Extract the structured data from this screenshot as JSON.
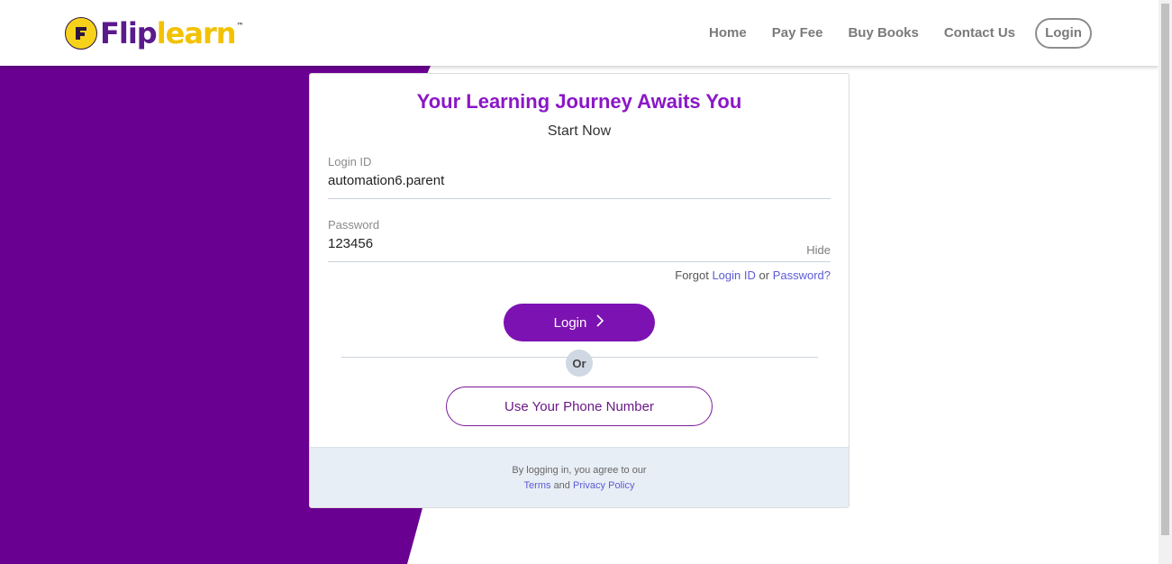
{
  "brand": {
    "name_part1": "Flip",
    "name_part2": "learn",
    "trademark": "™",
    "badge_letter": "F"
  },
  "nav": {
    "items": [
      {
        "label": "Home"
      },
      {
        "label": "Pay Fee"
      },
      {
        "label": "Buy Books"
      },
      {
        "label": "Contact Us"
      }
    ],
    "login_label": "Login"
  },
  "card": {
    "title": "Your Learning Journey Awaits You",
    "subtitle": "Start Now",
    "login_id": {
      "label": "Login ID",
      "value": "automation6.parent"
    },
    "password": {
      "label": "Password",
      "value": "123456",
      "toggle_label": "Hide"
    },
    "forgot": {
      "prefix": "Forgot",
      "login_id_link": "Login ID",
      "or_text": "or",
      "password_link": "Password?"
    },
    "login_button": "Login",
    "or_label": "Or",
    "phone_button": "Use Your Phone Number",
    "footer": {
      "line1": "By logging in, you agree to our",
      "terms_link": "Terms",
      "and_text": "and",
      "privacy_link": "Privacy Policy"
    }
  },
  "colors": {
    "brand_purple": "#6a0091",
    "accent_purple": "#7d12b3",
    "title_purple": "#8a17c6",
    "logo_yellow": "#f2c200",
    "link_blue": "#5b5bd6"
  },
  "icons": {
    "login_chevron": "chevron-right-icon"
  }
}
